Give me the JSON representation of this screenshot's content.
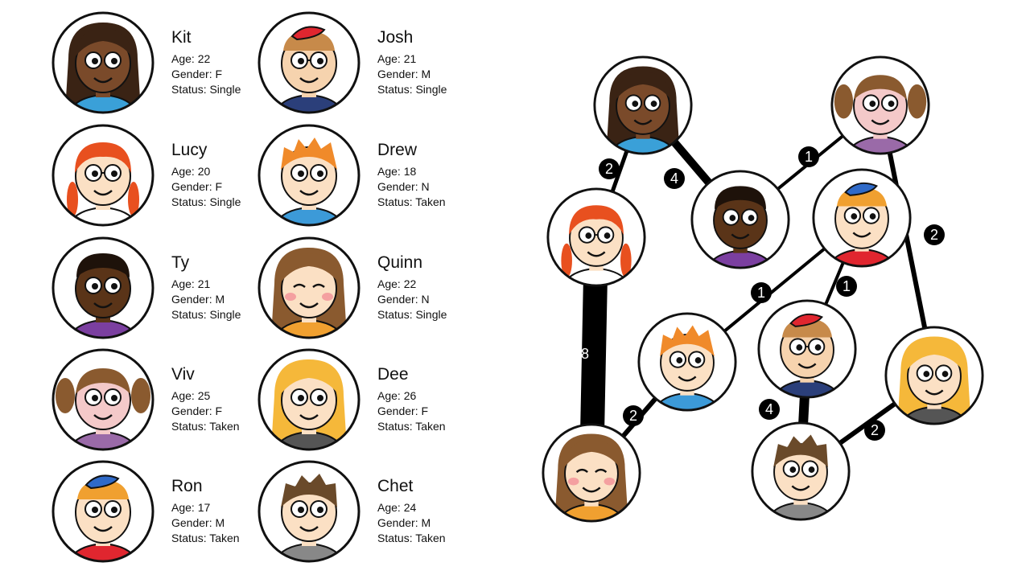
{
  "people": [
    {
      "id": "kit",
      "name": "Kit",
      "age": "Age: 22",
      "gender": "Gender: F",
      "status": "Status: Single",
      "skin": "#7a4a2a",
      "hair": "#3a2314",
      "hair_style": "long",
      "shirt": "#3aa0d8"
    },
    {
      "id": "josh",
      "name": "Josh",
      "age": "Age: 21",
      "gender": "Gender: M",
      "status": "Status: Single",
      "skin": "#f6d3ae",
      "hair": "#c78a4a",
      "hair_style": "cap",
      "shirt": "#2b3f7a",
      "cap": "#e0262f",
      "glasses": true
    },
    {
      "id": "lucy",
      "name": "Lucy",
      "age": "Age: 20",
      "gender": "Gender: F",
      "status": "Status: Single",
      "skin": "#fbe0c4",
      "hair": "#e8501f",
      "hair_style": "braids",
      "shirt": "#ffffff",
      "glasses": true
    },
    {
      "id": "drew",
      "name": "Drew",
      "age": "Age: 18",
      "gender": "Gender: N",
      "status": "Status: Taken",
      "skin": "#fbe0c4",
      "hair": "#f08a2a",
      "hair_style": "spiky",
      "shirt": "#3c9ad8"
    },
    {
      "id": "ty",
      "name": "Ty",
      "age": "Age: 21",
      "gender": "Gender: M",
      "status": "Status: Single",
      "skin": "#5a3418",
      "hair": "#1e120a",
      "hair_style": "curly",
      "shirt": "#7b3fa0"
    },
    {
      "id": "quinn",
      "name": "Quinn",
      "age": "Age: 22",
      "gender": "Gender: N",
      "status": "Status: Single",
      "skin": "#fbe0c4",
      "hair": "#8a5a2f",
      "hair_style": "bob",
      "shirt": "#f0a030",
      "closed_eyes": true
    },
    {
      "id": "viv",
      "name": "Viv",
      "age": "Age: 25",
      "gender": "Gender: F",
      "status": "Status: Taken",
      "skin": "#f4c9c9",
      "hair": "#8a5a2f",
      "hair_style": "pigtails",
      "shirt": "#9a6aa8"
    },
    {
      "id": "dee",
      "name": "Dee",
      "age": "Age: 26",
      "gender": "Gender: F",
      "status": "Status: Taken",
      "skin": "#fbe0c4",
      "hair": "#f5b83a",
      "hair_style": "longblonde",
      "shirt": "#555555"
    },
    {
      "id": "ron",
      "name": "Ron",
      "age": "Age: 17",
      "gender": "Gender: M",
      "status": "Status: Taken",
      "skin": "#fbe0c4",
      "hair": "#f0a030",
      "hair_style": "cap2",
      "shirt": "#e0262f",
      "cap": "#2f6ac8"
    },
    {
      "id": "chet",
      "name": "Chet",
      "age": "Age: 24",
      "gender": "Gender: M",
      "status": "Status: Taken",
      "skin": "#fbe0c4",
      "hair": "#6a4a2a",
      "hair_style": "messy",
      "shirt": "#888888"
    }
  ],
  "graph": {
    "edges": [
      {
        "from": "kit",
        "to": "lucy",
        "weight": "2"
      },
      {
        "from": "kit",
        "to": "ty",
        "weight": "4"
      },
      {
        "from": "ty",
        "to": "viv",
        "weight": "1"
      },
      {
        "from": "viv",
        "to": "dee",
        "weight": "2"
      },
      {
        "from": "ron",
        "to": "drew",
        "weight": "1"
      },
      {
        "from": "ron",
        "to": "josh",
        "weight": "1"
      },
      {
        "from": "lucy",
        "to": "quinn",
        "weight": "8"
      },
      {
        "from": "drew",
        "to": "quinn",
        "weight": "2"
      },
      {
        "from": "josh",
        "to": "chet",
        "weight": "4"
      },
      {
        "from": "chet",
        "to": "dee",
        "weight": "2"
      }
    ]
  },
  "colors": {
    "outline": "#111111",
    "badge": "#000000",
    "badge_text": "#ffffff"
  }
}
